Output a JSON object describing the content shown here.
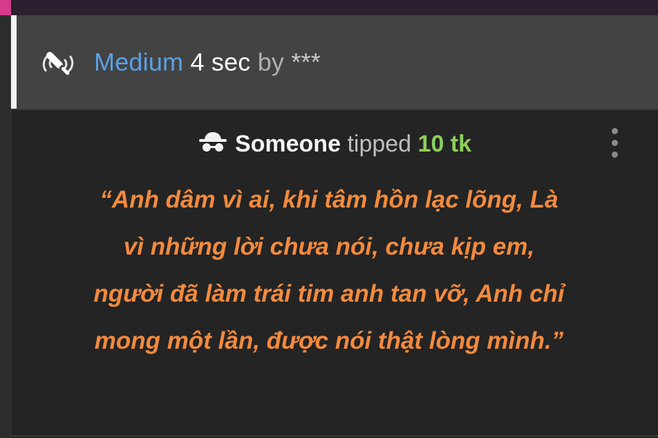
{
  "header": {
    "level": "Medium",
    "duration": "4 sec",
    "by_label": "by",
    "who": "***",
    "icon": "vibration-wand-icon"
  },
  "tip": {
    "tipper": "Someone",
    "verb": "tipped",
    "amount": "10 tk",
    "icon": "anonymous-spy-icon"
  },
  "message": {
    "text": "“Anh dâm vì ai, khi tâm hồn lạc lõng, Là vì những lời chưa nói, chưa kịp em, người đã làm trái tim anh tan vỡ, Anh chỉ mong một lần, được nói thật lòng mình.”"
  },
  "colors": {
    "level": "#5aa0e6",
    "amount": "#8cd05a",
    "message": "#f28a3e",
    "accent": "#d63a8a"
  }
}
